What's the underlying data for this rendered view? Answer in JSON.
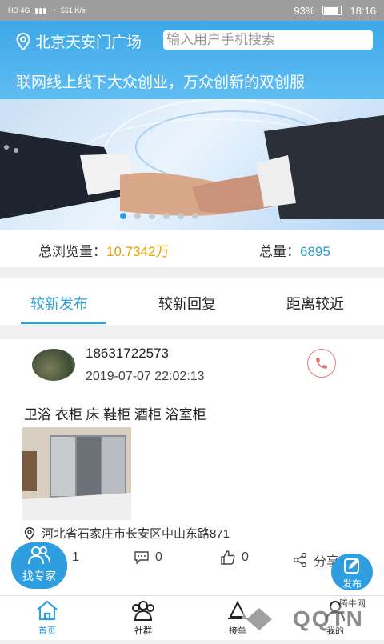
{
  "status_bar": {
    "network": "HD 4G",
    "speed": "551 K/s",
    "battery": "93%",
    "time": "18:16"
  },
  "header": {
    "location": "北京天安门广场",
    "search_placeholder": "输入用户手机搜索",
    "marquee": "联网线上线下大众创业，万众创新的双创服"
  },
  "banner": {
    "dot_count": 6,
    "active_index": 0
  },
  "stats": {
    "views_label": "总浏览量：",
    "views_value": "10.7342万",
    "total_label": "总量：",
    "total_value": "6895"
  },
  "tabs": [
    {
      "label": "较新发布",
      "active": true
    },
    {
      "label": "较新回复",
      "active": false
    },
    {
      "label": "距离较近",
      "active": false
    }
  ],
  "post": {
    "phone": "18631722573",
    "time": "2019-07-07 22:02:13",
    "tags": "卫浴 衣柜 床 鞋柜 酒柜 浴室柜",
    "address": "河北省石家庄市长安区中山东路871",
    "likes": "1",
    "comments": "0",
    "thumbs": "0",
    "share_label": "分享"
  },
  "floating": {
    "find_expert": "找专家",
    "publish": "发布"
  },
  "bottom_nav": [
    {
      "label": "首页",
      "active": true
    },
    {
      "label": "社群",
      "active": false
    },
    {
      "label": "接单",
      "active": false
    },
    {
      "label": "我的",
      "active": false
    }
  ],
  "watermark": {
    "brand": "QQTN",
    "site": "腾牛网"
  },
  "colors": {
    "accent": "#2f9de3",
    "header": "#4fb3ee",
    "yellow_value": "#e6a100",
    "call_red": "#e57a7a"
  }
}
